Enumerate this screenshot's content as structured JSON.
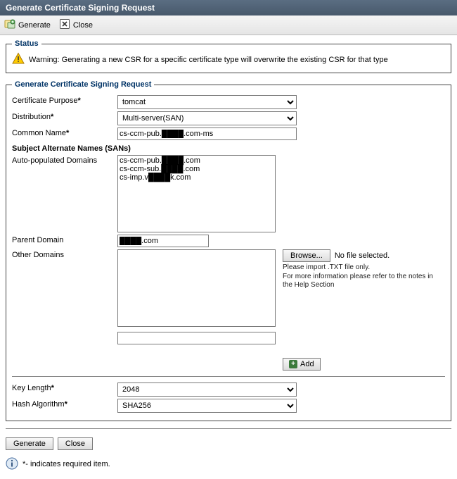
{
  "window": {
    "title": "Generate Certificate Signing Request"
  },
  "toolbar": {
    "generate": "Generate",
    "close": "Close"
  },
  "status": {
    "legend": "Status",
    "warning": "Warning: Generating a new CSR for a specific certificate type will overwrite the existing CSR for that type"
  },
  "form": {
    "legend": "Generate Certificate Signing Request",
    "labels": {
      "purpose": "Certificate Purpose",
      "distribution": "Distribution",
      "common_name": "Common Name",
      "san_heading": "Subject Alternate Names (SANs)",
      "auto_domains": "Auto-populated Domains",
      "parent_domain": "Parent Domain",
      "other_domains": "Other Domains",
      "key_length": "Key Length",
      "hash_algo": "Hash Algorithm"
    },
    "values": {
      "purpose": "tomcat",
      "distribution": "Multi-server(SAN)",
      "common_name": "cs-ccm-pub.████.com-ms",
      "auto_domains": "cs-ccm-pub.████.com\ncs-ccm-sub.████.com\ncs-imp.v████k.com",
      "parent_domain": "████.com",
      "other_domains": "",
      "other_domain_input": "",
      "key_length": "2048",
      "hash_algo": "SHA256"
    },
    "browse": {
      "button": "Browse...",
      "no_file": "No file selected.",
      "help": "Please import .TXT file only.\nFor more information please refer to the notes in the Help Section"
    },
    "add_button": "Add"
  },
  "footer": {
    "generate": "Generate",
    "close": "Close",
    "required_note": "*- indicates required item."
  }
}
